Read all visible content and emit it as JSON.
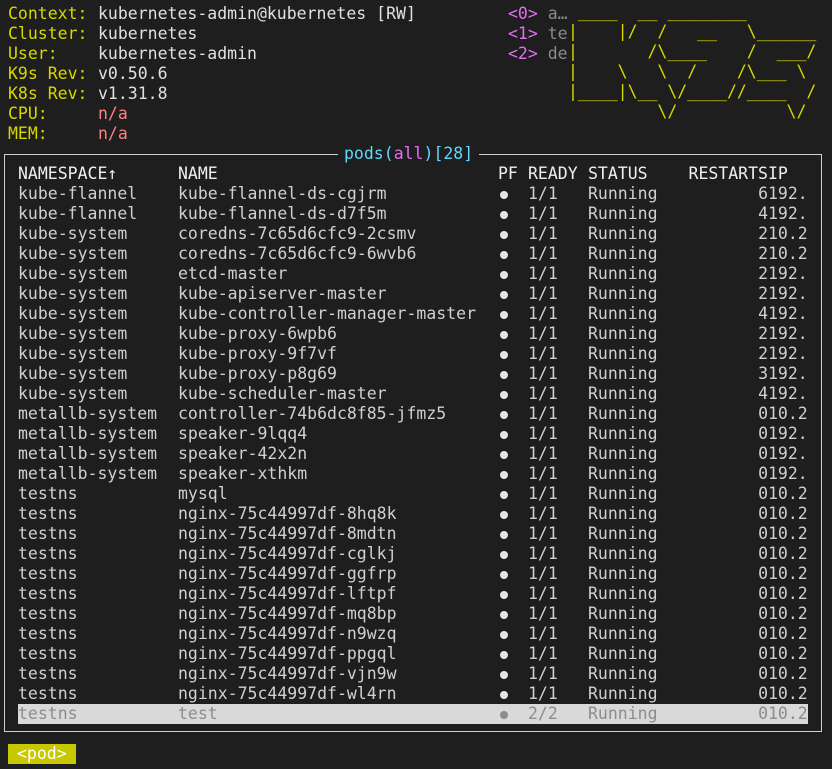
{
  "header": {
    "info": [
      {
        "label": "Context:",
        "value": "kubernetes-admin@kubernetes [RW]"
      },
      {
        "label": "Cluster:",
        "value": "kubernetes"
      },
      {
        "label": "User:",
        "value": "kubernetes-admin"
      },
      {
        "label": "K9s Rev:",
        "value": "v0.50.6"
      },
      {
        "label": "K8s Rev:",
        "value": "v1.31.8"
      },
      {
        "label": "CPU:",
        "value": "n/a"
      },
      {
        "label": "MEM:",
        "value": "n/a"
      }
    ],
    "shortcuts": [
      {
        "key": "<0>",
        "text": "a…"
      },
      {
        "key": "<1>",
        "text": "te"
      },
      {
        "key": "<2>",
        "text": "de"
      }
    ],
    "logo_text": "K9s"
  },
  "table": {
    "title_resource": "pods",
    "title_scope": "all",
    "title_count": "28",
    "columns": {
      "namespace": "NAMESPACE↑",
      "name": "NAME",
      "pf": "PF",
      "ready": "READY",
      "status": "STATUS",
      "restarts": "RESTARTS",
      "ip": "IP"
    },
    "rows": [
      {
        "namespace": "kube-flannel",
        "name": "kube-flannel-ds-cgjrm",
        "ready": "1/1",
        "status": "Running",
        "restarts": "6",
        "ip": "192."
      },
      {
        "namespace": "kube-flannel",
        "name": "kube-flannel-ds-d7f5m",
        "ready": "1/1",
        "status": "Running",
        "restarts": "4",
        "ip": "192."
      },
      {
        "namespace": "kube-system",
        "name": "coredns-7c65d6cfc9-2csmv",
        "ready": "1/1",
        "status": "Running",
        "restarts": "2",
        "ip": "10.2"
      },
      {
        "namespace": "kube-system",
        "name": "coredns-7c65d6cfc9-6wvb6",
        "ready": "1/1",
        "status": "Running",
        "restarts": "2",
        "ip": "10.2"
      },
      {
        "namespace": "kube-system",
        "name": "etcd-master",
        "ready": "1/1",
        "status": "Running",
        "restarts": "2",
        "ip": "192."
      },
      {
        "namespace": "kube-system",
        "name": "kube-apiserver-master",
        "ready": "1/1",
        "status": "Running",
        "restarts": "2",
        "ip": "192."
      },
      {
        "namespace": "kube-system",
        "name": "kube-controller-manager-master",
        "ready": "1/1",
        "status": "Running",
        "restarts": "4",
        "ip": "192."
      },
      {
        "namespace": "kube-system",
        "name": "kube-proxy-6wpb6",
        "ready": "1/1",
        "status": "Running",
        "restarts": "2",
        "ip": "192."
      },
      {
        "namespace": "kube-system",
        "name": "kube-proxy-9f7vf",
        "ready": "1/1",
        "status": "Running",
        "restarts": "2",
        "ip": "192."
      },
      {
        "namespace": "kube-system",
        "name": "kube-proxy-p8g69",
        "ready": "1/1",
        "status": "Running",
        "restarts": "3",
        "ip": "192."
      },
      {
        "namespace": "kube-system",
        "name": "kube-scheduler-master",
        "ready": "1/1",
        "status": "Running",
        "restarts": "4",
        "ip": "192."
      },
      {
        "namespace": "metallb-system",
        "name": "controller-74b6dc8f85-jfmz5",
        "ready": "1/1",
        "status": "Running",
        "restarts": "0",
        "ip": "10.2"
      },
      {
        "namespace": "metallb-system",
        "name": "speaker-9lqq4",
        "ready": "1/1",
        "status": "Running",
        "restarts": "0",
        "ip": "192."
      },
      {
        "namespace": "metallb-system",
        "name": "speaker-42x2n",
        "ready": "1/1",
        "status": "Running",
        "restarts": "0",
        "ip": "192."
      },
      {
        "namespace": "metallb-system",
        "name": "speaker-xthkm",
        "ready": "1/1",
        "status": "Running",
        "restarts": "0",
        "ip": "192."
      },
      {
        "namespace": "testns",
        "name": "mysql",
        "ready": "1/1",
        "status": "Running",
        "restarts": "0",
        "ip": "10.2"
      },
      {
        "namespace": "testns",
        "name": "nginx-75c44997df-8hq8k",
        "ready": "1/1",
        "status": "Running",
        "restarts": "0",
        "ip": "10.2"
      },
      {
        "namespace": "testns",
        "name": "nginx-75c44997df-8mdtn",
        "ready": "1/1",
        "status": "Running",
        "restarts": "0",
        "ip": "10.2"
      },
      {
        "namespace": "testns",
        "name": "nginx-75c44997df-cglkj",
        "ready": "1/1",
        "status": "Running",
        "restarts": "0",
        "ip": "10.2"
      },
      {
        "namespace": "testns",
        "name": "nginx-75c44997df-ggfrp",
        "ready": "1/1",
        "status": "Running",
        "restarts": "0",
        "ip": "10.2"
      },
      {
        "namespace": "testns",
        "name": "nginx-75c44997df-lftpf",
        "ready": "1/1",
        "status": "Running",
        "restarts": "0",
        "ip": "10.2"
      },
      {
        "namespace": "testns",
        "name": "nginx-75c44997df-mq8bp",
        "ready": "1/1",
        "status": "Running",
        "restarts": "0",
        "ip": "10.2"
      },
      {
        "namespace": "testns",
        "name": "nginx-75c44997df-n9wzq",
        "ready": "1/1",
        "status": "Running",
        "restarts": "0",
        "ip": "10.2"
      },
      {
        "namespace": "testns",
        "name": "nginx-75c44997df-ppgql",
        "ready": "1/1",
        "status": "Running",
        "restarts": "0",
        "ip": "10.2"
      },
      {
        "namespace": "testns",
        "name": "nginx-75c44997df-vjn9w",
        "ready": "1/1",
        "status": "Running",
        "restarts": "0",
        "ip": "10.2"
      },
      {
        "namespace": "testns",
        "name": "nginx-75c44997df-wl4rn",
        "ready": "1/1",
        "status": "Running",
        "restarts": "0",
        "ip": "10.2"
      },
      {
        "namespace": "testns",
        "name": "test",
        "ready": "2/2",
        "status": "Running",
        "restarts": "0",
        "ip": "10.2",
        "selected": true
      }
    ]
  },
  "crumb": {
    "label": "<pod>"
  },
  "colors": {
    "label_yellow": "#d7d700",
    "na_red": "#ff8080",
    "shortcut_magenta": "#e36ef0",
    "title_cyan": "#5fd7ff",
    "crumb_bg": "#c8c800",
    "selected_bg": "#d9d9d9"
  }
}
